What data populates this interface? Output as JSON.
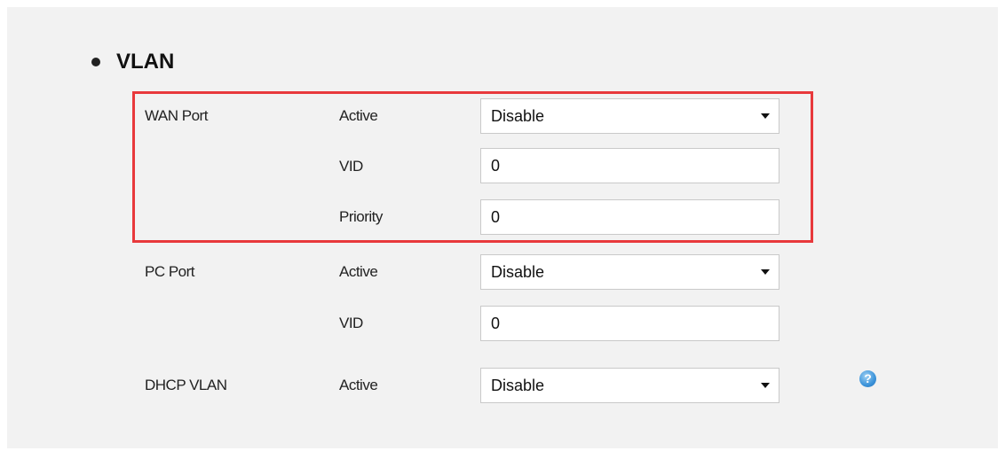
{
  "section": {
    "title": "VLAN"
  },
  "wan_port": {
    "label": "WAN Port",
    "active": {
      "label": "Active",
      "value": "Disable"
    },
    "vid": {
      "label": "VID",
      "value": "0"
    },
    "priority": {
      "label": "Priority",
      "value": "0"
    }
  },
  "pc_port": {
    "label": "PC Port",
    "active": {
      "label": "Active",
      "value": "Disable"
    },
    "vid": {
      "label": "VID",
      "value": "0"
    }
  },
  "dhcp_vlan": {
    "label": "DHCP VLAN",
    "active": {
      "label": "Active",
      "value": "Disable"
    }
  },
  "help": {
    "glyph": "?"
  },
  "colors": {
    "highlight": "#e8393c",
    "panel_background": "#f2f2f2",
    "help_icon": "#3b93da"
  },
  "icons": [
    "bullet-icon",
    "dropdown-caret-icon",
    "help-icon"
  ]
}
